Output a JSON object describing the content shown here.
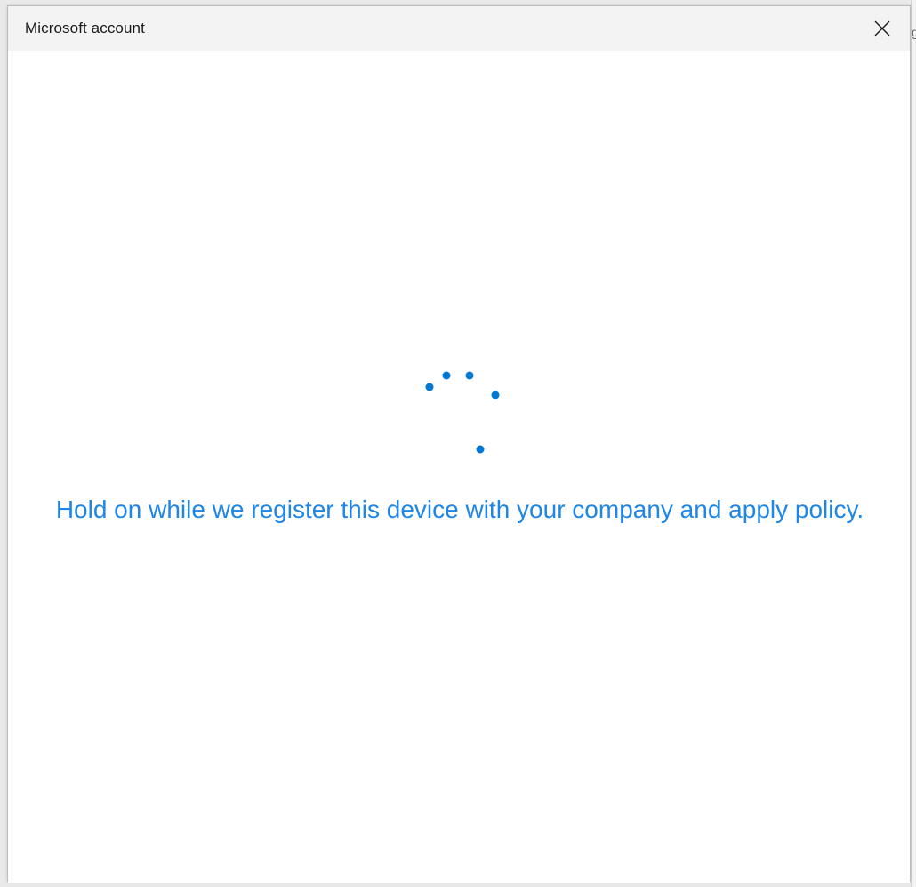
{
  "window": {
    "title": "Microsoft account",
    "close_icon": "close-icon"
  },
  "main": {
    "spinner_icon": "progress-ring-icon",
    "message": "Hold on while we register this device with your company and apply policy."
  },
  "colors": {
    "accent": "#0078d4",
    "message_text": "#1e86e6",
    "titlebar_bg": "#f3f3f3"
  }
}
